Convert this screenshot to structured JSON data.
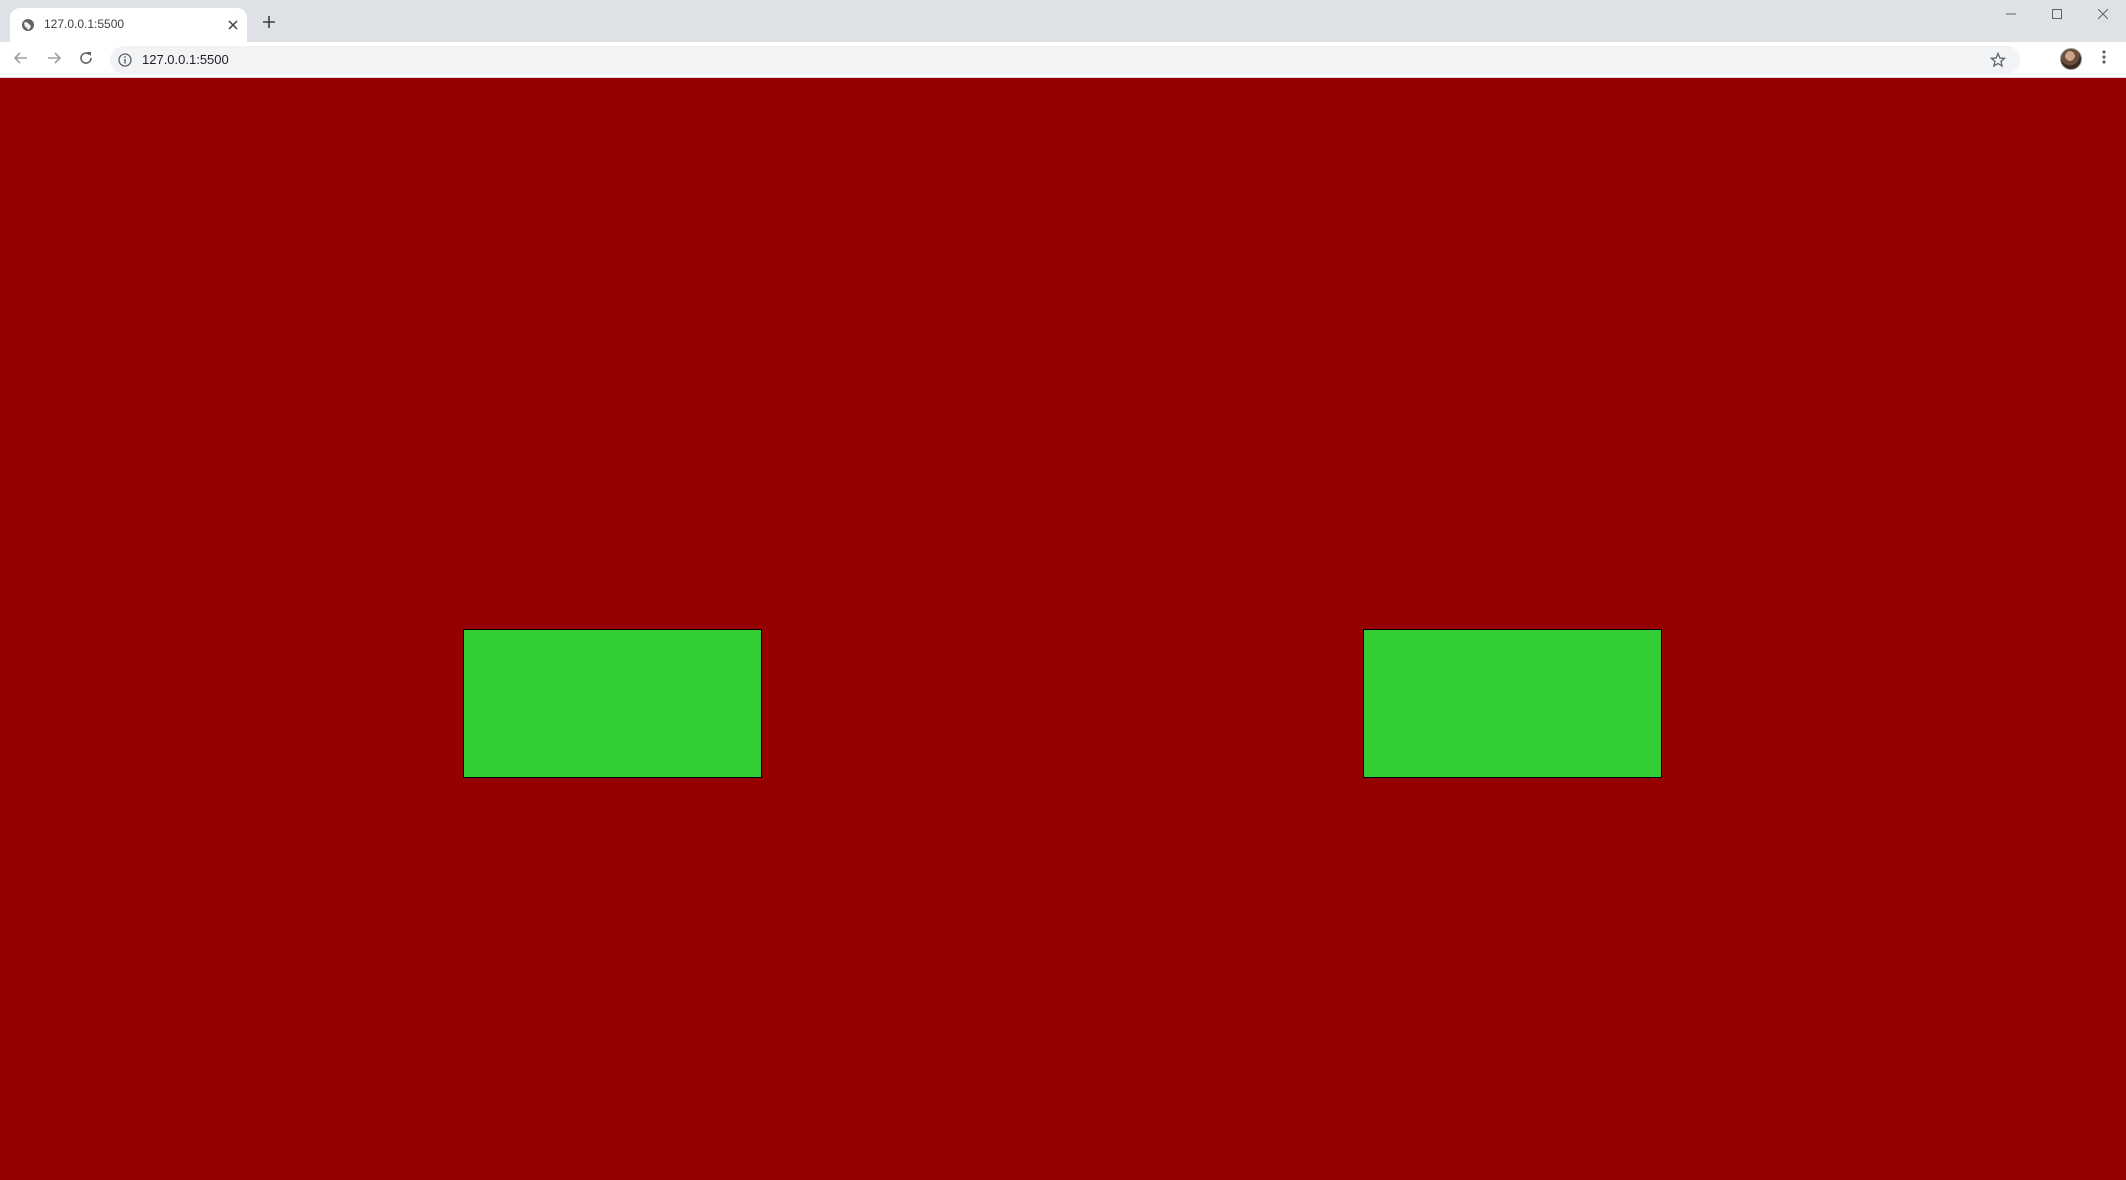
{
  "browser": {
    "tab": {
      "title": "127.0.0.1:5500",
      "favicon": "globe-icon",
      "close_icon": "close-icon"
    },
    "new_tab_icon": "plus-icon",
    "window_controls": [
      "minimize-icon",
      "maximize-icon",
      "close-icon"
    ],
    "toolbar": {
      "back_icon": "arrow-left-icon",
      "forward_icon": "arrow-right-icon",
      "reload_icon": "reload-icon",
      "site_info_icon": "info-icon",
      "url": "127.0.0.1:5500",
      "bookmark_icon": "star-icon",
      "menu_icon": "kebab-menu-icon"
    }
  },
  "page": {
    "background_color": "#950000",
    "boxes": [
      {
        "name": "left-box",
        "color": "#32cd32"
      },
      {
        "name": "right-box",
        "color": "#32cd32"
      }
    ]
  }
}
